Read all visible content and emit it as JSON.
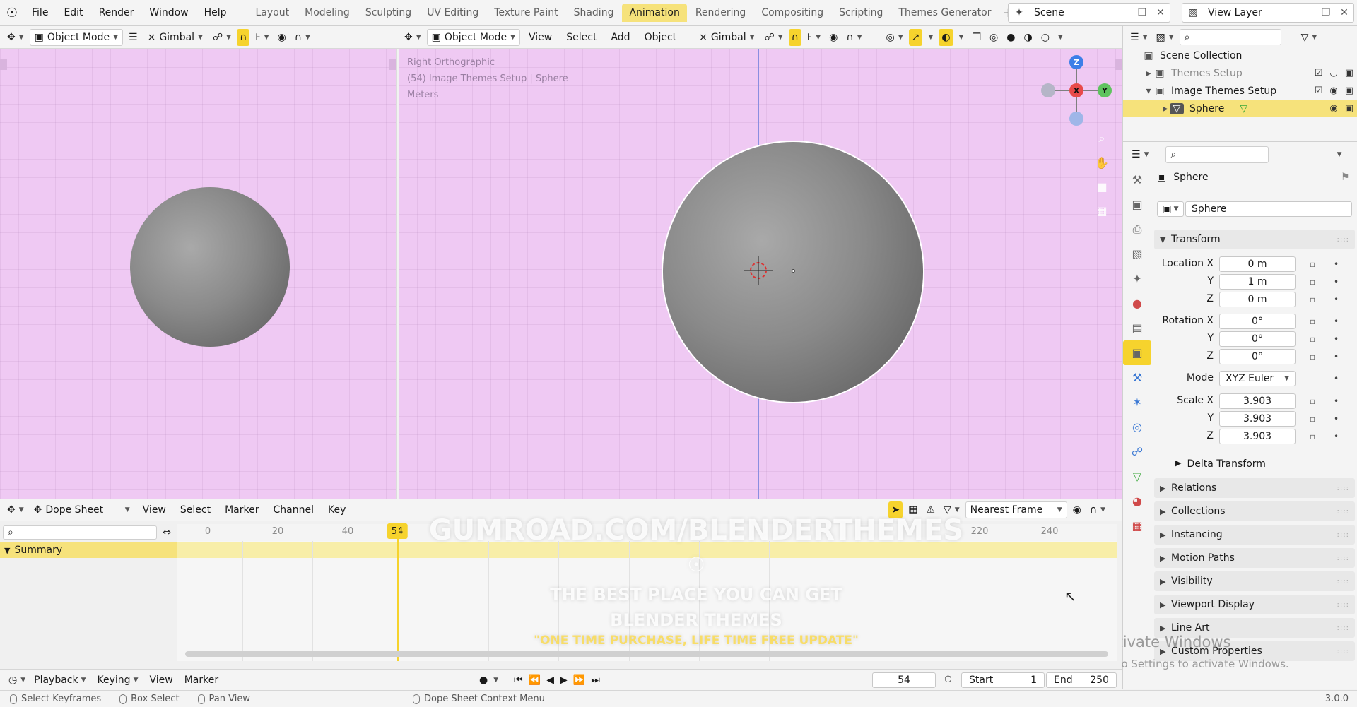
{
  "menu": [
    "File",
    "Edit",
    "Render",
    "Window",
    "Help"
  ],
  "workspaces": [
    "Layout",
    "Modeling",
    "Sculpting",
    "UV Editing",
    "Texture Paint",
    "Shading",
    "Animation",
    "Rendering",
    "Compositing",
    "Scripting",
    "Themes Generator"
  ],
  "active_workspace": "Animation",
  "scene": "Scene",
  "view_layer": "View Layer",
  "left_header": {
    "mode": "Object Mode",
    "orientation": "Gimbal"
  },
  "main_header": {
    "mode": "Object Mode",
    "menus": [
      "View",
      "Select",
      "Add",
      "Object"
    ],
    "orientation": "Gimbal"
  },
  "viewport_info": [
    "Right Orthographic",
    "(54) Image Themes Setup | Sphere",
    "Meters"
  ],
  "gizmo": {
    "z": "Z",
    "x": "X",
    "y": "Y"
  },
  "outliner": {
    "rows": [
      {
        "label": "Scene Collection"
      },
      {
        "label": "Themes Setup"
      },
      {
        "label": "Image Themes Setup"
      },
      {
        "label": "Sphere"
      }
    ]
  },
  "properties": {
    "object_name": "Sphere",
    "data_name": "Sphere",
    "transform_label": "Transform",
    "location_label": "Location X",
    "rotation_label": "Rotation X",
    "scale_label": "Scale X",
    "y_label": "Y",
    "z_label": "Z",
    "mode_label": "Mode",
    "location": [
      "0 m",
      "1 m",
      "0 m"
    ],
    "rotation": [
      "0°",
      "0°",
      "0°"
    ],
    "rotation_mode": "XYZ Euler",
    "scale": [
      "3.903",
      "3.903",
      "3.903"
    ],
    "delta_label": "Delta Transform",
    "panels": [
      "Relations",
      "Collections",
      "Instancing",
      "Motion Paths",
      "Visibility",
      "Viewport Display",
      "Line Art",
      "Custom Properties"
    ]
  },
  "dopesheet": {
    "mode": "Dope Sheet",
    "menus": [
      "View",
      "Select",
      "Marker",
      "Channel",
      "Key"
    ],
    "snap": "Nearest Frame",
    "summary": "Summary",
    "ticks": [
      "0",
      "20",
      "40",
      "220",
      "240"
    ],
    "current_frame": "54"
  },
  "watermark": {
    "line1": "GUMROAD.COM/BLENDERTHEMES",
    "line2": "THE BEST PLACE YOU CAN GET",
    "line3": "BLENDER THEMES",
    "line4": "\"ONE TIME PURCHASE, LIFE TIME FREE UPDATE\""
  },
  "timeline": {
    "menus": [
      "Playback",
      "Keying",
      "View",
      "Marker"
    ],
    "frame": "54",
    "start_label": "Start",
    "start": "1",
    "end_label": "End",
    "end": "250"
  },
  "statusbar": {
    "items": [
      "Select Keyframes",
      "Box Select",
      "Pan View",
      "Dope Sheet Context Menu"
    ],
    "version": "3.0.0"
  },
  "activate_windows": {
    "title": "Activate Windows",
    "subtitle": "Go to Settings to activate Windows."
  },
  "colors": {
    "viewport_bg": "#efc9f3",
    "accent": "#f6d32d",
    "selected_row": "#f6e27b"
  }
}
